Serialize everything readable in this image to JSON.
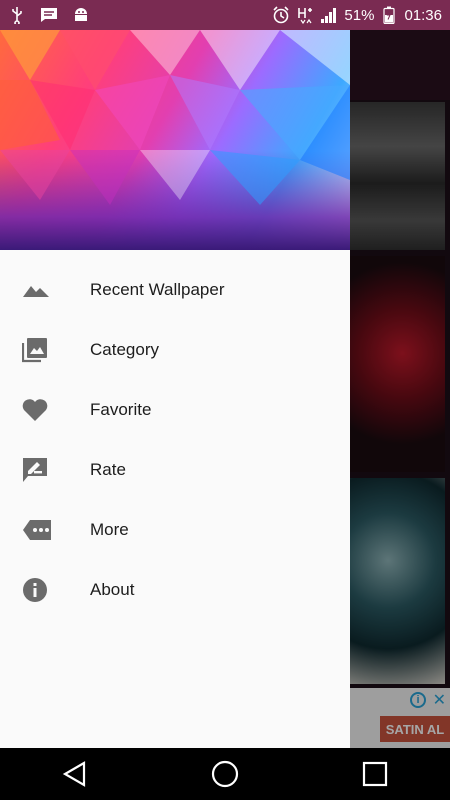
{
  "status_bar": {
    "battery_percent": "51%",
    "time": "01:36",
    "icons": [
      "usb-icon",
      "message-icon",
      "android-debug-icon",
      "alarm-icon",
      "h-plus-icon",
      "signal-icon",
      "battery-icon"
    ]
  },
  "drawer": {
    "items": [
      {
        "label": "Recent Wallpaper",
        "icon": "landscape-icon"
      },
      {
        "label": "Category",
        "icon": "photo-library-icon"
      },
      {
        "label": "Favorite",
        "icon": "heart-icon"
      },
      {
        "label": "Rate",
        "icon": "rate-review-icon"
      },
      {
        "label": "More",
        "icon": "more-tag-icon"
      },
      {
        "label": "About",
        "icon": "info-icon"
      }
    ]
  },
  "ad": {
    "button_label": "SATIN AL"
  },
  "colors": {
    "status_bar": "#7a2b52",
    "icon_gray": "#6b6b6b",
    "drawer_bg": "#fafafa"
  }
}
